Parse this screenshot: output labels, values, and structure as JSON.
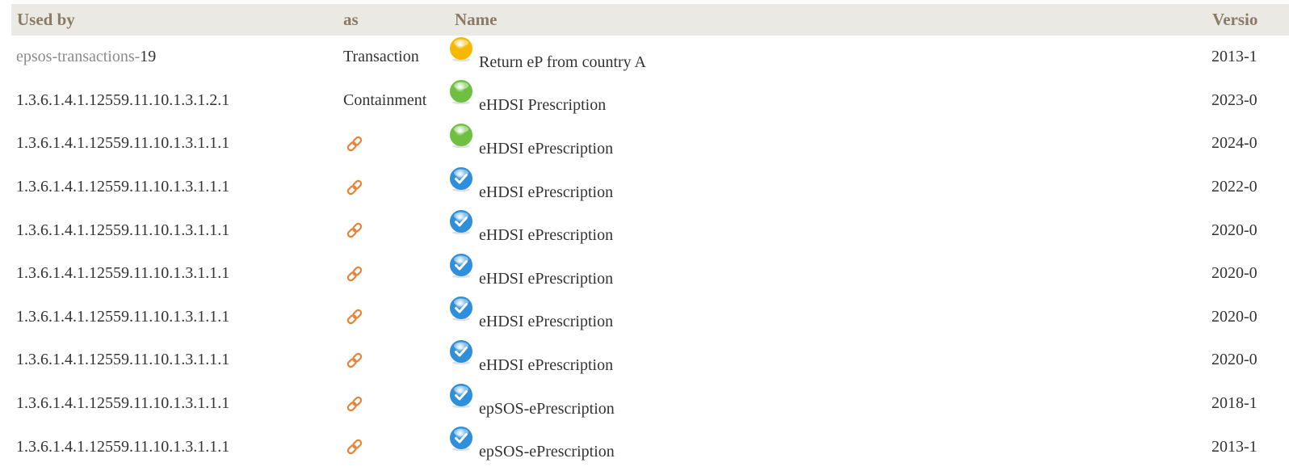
{
  "table": {
    "headers": {
      "used_by": "Used by",
      "as": "as",
      "name": "Name",
      "version": "Versio"
    },
    "rows": [
      {
        "used_by_prefix": "epsos-transactions-",
        "used_by_suffix": "19",
        "as": "Transaction",
        "as_icon": "",
        "status_icon": "status-draft-icon",
        "name": "Return eP from country A",
        "version": "2013-1"
      },
      {
        "used_by_prefix": "",
        "used_by_suffix": "1.3.6.1.4.1.12559.11.10.1.3.1.2.1",
        "as": "Containment",
        "as_icon": "",
        "status_icon": "status-active-icon",
        "name": "eHDSI Prescription",
        "version": "2023-0"
      },
      {
        "used_by_prefix": "",
        "used_by_suffix": "1.3.6.1.4.1.12559.11.10.1.3.1.1.1",
        "as": "",
        "as_icon": "link-icon",
        "status_icon": "status-active-icon",
        "name": "eHDSI ePrescription",
        "version": "2024-0"
      },
      {
        "used_by_prefix": "",
        "used_by_suffix": "1.3.6.1.4.1.12559.11.10.1.3.1.1.1",
        "as": "",
        "as_icon": "link-icon",
        "status_icon": "status-final-icon",
        "name": "eHDSI ePrescription",
        "version": "2022-0"
      },
      {
        "used_by_prefix": "",
        "used_by_suffix": "1.3.6.1.4.1.12559.11.10.1.3.1.1.1",
        "as": "",
        "as_icon": "link-icon",
        "status_icon": "status-final-icon",
        "name": "eHDSI ePrescription",
        "version": "2020-0"
      },
      {
        "used_by_prefix": "",
        "used_by_suffix": "1.3.6.1.4.1.12559.11.10.1.3.1.1.1",
        "as": "",
        "as_icon": "link-icon",
        "status_icon": "status-final-icon",
        "name": "eHDSI ePrescription",
        "version": "2020-0"
      },
      {
        "used_by_prefix": "",
        "used_by_suffix": "1.3.6.1.4.1.12559.11.10.1.3.1.1.1",
        "as": "",
        "as_icon": "link-icon",
        "status_icon": "status-final-icon",
        "name": "eHDSI ePrescription",
        "version": "2020-0"
      },
      {
        "used_by_prefix": "",
        "used_by_suffix": "1.3.6.1.4.1.12559.11.10.1.3.1.1.1",
        "as": "",
        "as_icon": "link-icon",
        "status_icon": "status-final-icon",
        "name": "eHDSI ePrescription",
        "version": "2020-0"
      },
      {
        "used_by_prefix": "",
        "used_by_suffix": "1.3.6.1.4.1.12559.11.10.1.3.1.1.1",
        "as": "",
        "as_icon": "link-icon",
        "status_icon": "status-final-icon",
        "name": "epSOS-ePrescription",
        "version": "2018-1"
      },
      {
        "used_by_prefix": "",
        "used_by_suffix": "1.3.6.1.4.1.12559.11.10.1.3.1.1.1",
        "as": "",
        "as_icon": "link-icon",
        "status_icon": "status-final-icon",
        "name": "epSOS-ePrescription",
        "version": "2013-1"
      }
    ]
  },
  "colors": {
    "header_background": "#ebe9e4",
    "header_text": "#8a7a66",
    "body_text": "#333333",
    "muted_text": "#8b8b8b",
    "link_icon": "#e8833a",
    "draft_orb": "#f6b800",
    "active_orb": "#6fc040",
    "final_orb": "#2f8fdb"
  }
}
